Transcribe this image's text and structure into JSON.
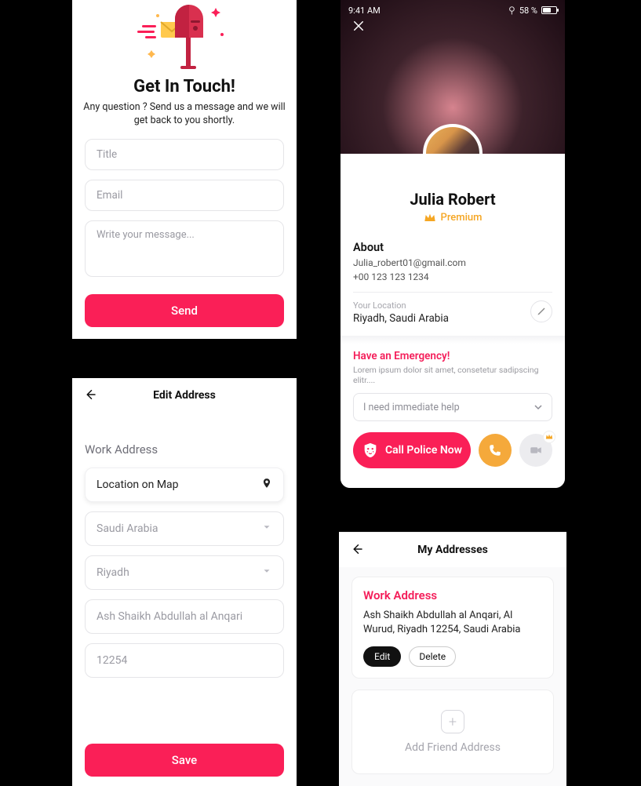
{
  "colors": {
    "accent": "#fa1f57",
    "gold": "#f5a623",
    "orange": "#f5a93b"
  },
  "screen1": {
    "title": "Get In Touch!",
    "subtitle": "Any question ? Send us a message and we will get back to you shortly.",
    "title_placeholder": "Title",
    "email_placeholder": "Email",
    "message_placeholder": "Write your message...",
    "send_label": "Send"
  },
  "screen2": {
    "status_time": "9:41 AM",
    "battery_pct": "58 %",
    "name": "Julia Robert",
    "premium_label": "Premium",
    "about_heading": "About",
    "email": "Julia_robert01@gmail.com",
    "phone": "+00 123 123 1234",
    "location_label": "Your Location",
    "location_value": "Riyadh, Saudi Arabia",
    "emergency_heading": "Have an Emergency!",
    "emergency_sub": "Lorem ipsum dolor sit amet, consetetur sadipscing elitr....",
    "help_select": "I need immediate help",
    "call_police_label": "Call Police Now"
  },
  "screen3": {
    "header_title": "Edit Address",
    "section_label": "Work Address",
    "map_label": "Location on Map",
    "country": "Saudi Arabia",
    "city": "Riyadh",
    "street": "Ash Shaikh Abdullah al Anqari",
    "postal": "12254",
    "save_label": "Save"
  },
  "screen4": {
    "header_title": "My Addresses",
    "card_title": "Work Address",
    "address": "Ash Shaikh Abdullah al Anqari, Al Wurud, Riyadh 12254, Saudi Arabia",
    "edit_label": "Edit",
    "delete_label": "Delete",
    "add_label": "Add Friend Address"
  }
}
